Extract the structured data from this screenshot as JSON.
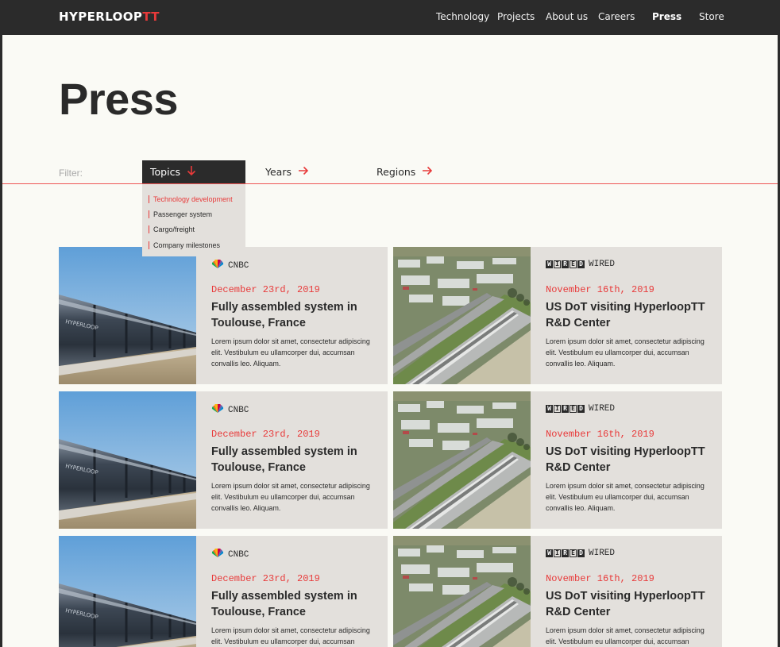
{
  "brand": {
    "main": "HYPERLOOP",
    "accent": "TT",
    "accent_color": "#e83a3a"
  },
  "nav": [
    {
      "label": "Technology",
      "active": false
    },
    {
      "label": "Projects",
      "active": false
    },
    {
      "label": "About us",
      "active": false
    },
    {
      "label": "Careers",
      "active": false
    },
    {
      "label": "Press",
      "active": true
    },
    {
      "label": "Store",
      "active": false
    }
  ],
  "page": {
    "title": "Press"
  },
  "filter": {
    "label": "Filter:",
    "tabs": [
      {
        "label": "Topics",
        "icon": "arrow-down-icon",
        "open": true
      },
      {
        "label": "Years",
        "icon": "arrow-right-icon",
        "open": false
      },
      {
        "label": "Regions",
        "icon": "arrow-right-icon",
        "open": false
      }
    ],
    "topics": [
      {
        "label": "Technology development",
        "selected": true
      },
      {
        "label": "Passenger system",
        "selected": false
      },
      {
        "label": "Cargo/freight",
        "selected": false
      },
      {
        "label": "Company milestones",
        "selected": false
      }
    ]
  },
  "articles": [
    {
      "source": "CNBC",
      "source_icon": "cnbc-peacock-icon",
      "date": "December 23rd, 2019",
      "headline": "Fully assembled system in Toulouse, France",
      "body": "Lorem ipsum dolor sit amet, consectetur adipiscing elit. Vestibulum eu ullamcorper dui, accumsan convallis leo. Aliquam.",
      "image": "hyperloop-tube-photo"
    },
    {
      "source": "WIRED",
      "source_icon": "wired-logo-icon",
      "date": "November 16th, 2019",
      "headline": "US DoT visiting HyperloopTT R&D Center",
      "body": "Lorem ipsum dolor sit amet, consectetur adipiscing elit. Vestibulum eu ullamcorper dui, accumsan convallis leo. Aliquam.",
      "image": "aerial-test-track-photo"
    },
    {
      "source": "CNBC",
      "source_icon": "cnbc-peacock-icon",
      "date": "December 23rd, 2019",
      "headline": "Fully assembled system in Toulouse, France",
      "body": "Lorem ipsum dolor sit amet, consectetur adipiscing elit. Vestibulum eu ullamcorper dui, accumsan convallis leo. Aliquam.",
      "image": "hyperloop-tube-photo"
    },
    {
      "source": "WIRED",
      "source_icon": "wired-logo-icon",
      "date": "November 16th, 2019",
      "headline": "US DoT visiting HyperloopTT R&D Center",
      "body": "Lorem ipsum dolor sit amet, consectetur adipiscing elit. Vestibulum eu ullamcorper dui, accumsan convallis leo. Aliquam.",
      "image": "aerial-test-track-photo"
    },
    {
      "source": "CNBC",
      "source_icon": "cnbc-peacock-icon",
      "date": "December 23rd, 2019",
      "headline": "Fully assembled system in Toulouse, France",
      "body": "Lorem ipsum dolor sit amet, consectetur adipiscing elit. Vestibulum eu ullamcorper dui, accumsan convallis leo. Aliquam.",
      "image": "hyperloop-tube-photo"
    },
    {
      "source": "WIRED",
      "source_icon": "wired-logo-icon",
      "date": "November 16th, 2019",
      "headline": "US DoT visiting HyperloopTT R&D Center",
      "body": "Lorem ipsum dolor sit amet, consectetur adipiscing elit. Vestibulum eu ullamcorper dui, accumsan convallis leo. Aliquam.",
      "image": "aerial-test-track-photo"
    }
  ]
}
